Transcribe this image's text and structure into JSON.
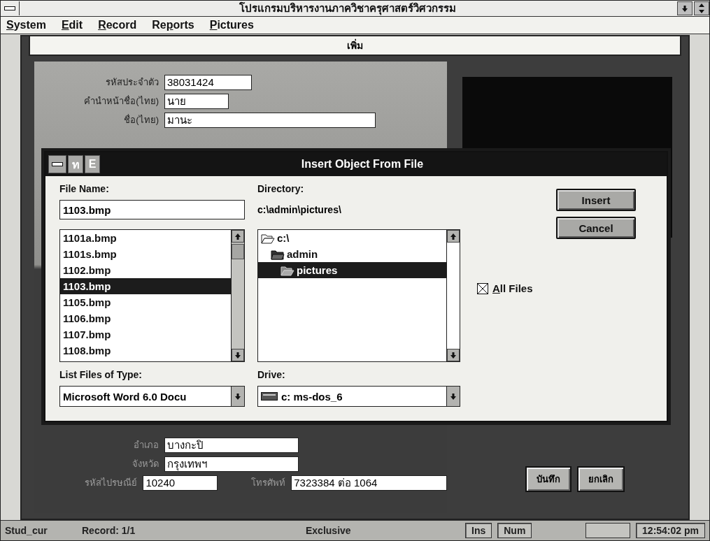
{
  "window": {
    "title": "โปรแกรมบริหารงานภาควิชาครุศาสตร์วิศวกรรม"
  },
  "menu": [
    {
      "key": "S",
      "rest": "ystem"
    },
    {
      "key": "E",
      "rest": "dit"
    },
    {
      "key": "R",
      "rest": "ecord"
    },
    {
      "lead": "Re",
      "key": "p",
      "rest": "orts"
    },
    {
      "key": "P",
      "rest": "ictures"
    }
  ],
  "form": {
    "title": "เพิ่ม",
    "fields_top": [
      {
        "label": "รหัสประจำตัว",
        "value": "38031424"
      },
      {
        "label": "คำนำหน้าชื่อ(ไทย)",
        "value": "นาย"
      },
      {
        "label": "ชื่อ(ไทย)",
        "value": "มานะ"
      }
    ],
    "fields_bottom": [
      {
        "label": "อำเภอ",
        "value": "บางกะปิ"
      },
      {
        "label": "จังหวัด",
        "value": "กรุงเทพฯ"
      },
      {
        "label": "รหัสไปรษณีย์",
        "value": "10240"
      }
    ],
    "phone": {
      "label": "โทรศัพท์",
      "value": "7323384 ต่อ 1064"
    },
    "buttons": [
      "บันทึก",
      "ยกเลิก"
    ]
  },
  "dialog": {
    "title": "Insert Object From File",
    "control_box": [
      "ท",
      "E"
    ],
    "file_name": {
      "label": "File Name:",
      "value": "1103.bmp"
    },
    "files": [
      {
        "name": "1101a.bmp",
        "selected": false
      },
      {
        "name": "1101s.bmp",
        "selected": false
      },
      {
        "name": "1102.bmp",
        "selected": false
      },
      {
        "name": "1103.bmp",
        "selected": true
      },
      {
        "name": "1105.bmp",
        "selected": false
      },
      {
        "name": "1106.bmp",
        "selected": false
      },
      {
        "name": "1107.bmp",
        "selected": false
      },
      {
        "name": "1108.bmp",
        "selected": false
      }
    ],
    "file_type": {
      "label": "List Files of Type:",
      "value": "Microsoft Word 6.0 Docu"
    },
    "directory": {
      "label": "Directory:",
      "path": "c:\\admin\\pictures\\"
    },
    "folders": [
      {
        "name": "c:\\",
        "selected": false,
        "children": [
          {
            "name": "admin",
            "selected": false,
            "children": [
              {
                "name": "pictures",
                "selected": true
              }
            ]
          }
        ]
      }
    ],
    "drive": {
      "label": "Drive:",
      "value": "c: ms-dos_6"
    },
    "buttons": [
      "Insert",
      "Cancel"
    ],
    "all_files": {
      "key": "A",
      "rest": "ll Files",
      "checked": true
    }
  },
  "status_bar": [
    {
      "text": "Stud_cur",
      "kind": "plain"
    },
    {
      "text": "Record: 1/1",
      "kind": "plain"
    },
    {
      "text": "Exclusive",
      "kind": "plain"
    },
    {
      "text": "Ins",
      "kind": "panel"
    },
    {
      "text": "Num",
      "kind": "panel"
    },
    {
      "text": "12:54:02 pm",
      "kind": "panel"
    }
  ]
}
